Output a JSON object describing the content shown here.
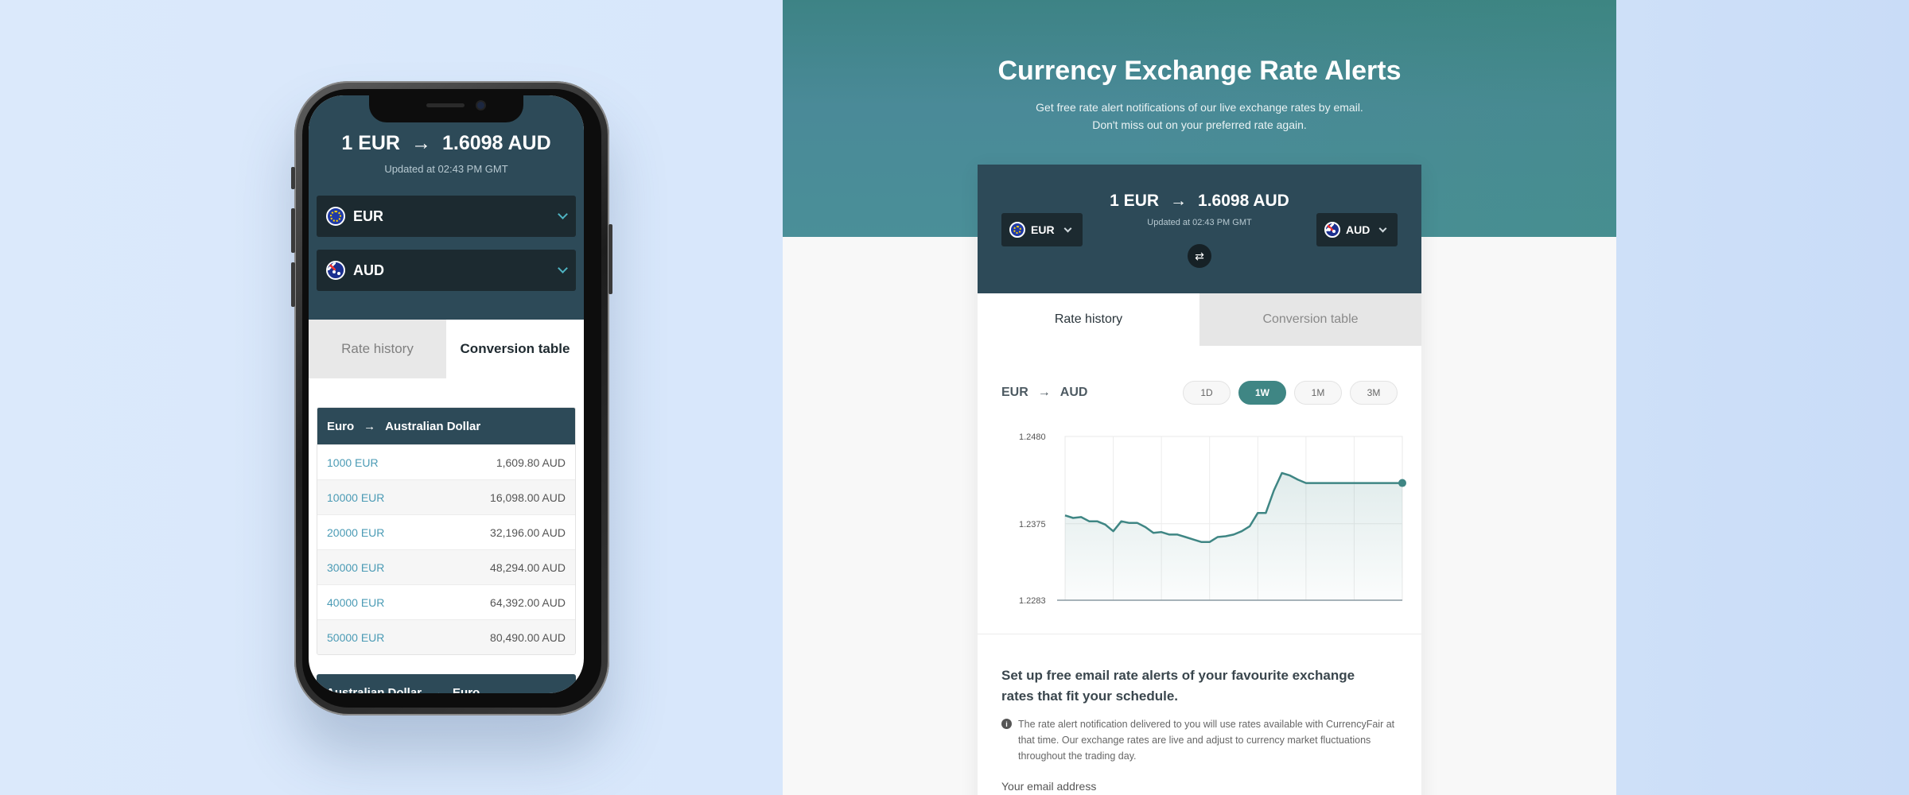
{
  "rate": {
    "from_text": "1 EUR",
    "to_text": "1.6098 AUD",
    "updated": "Updated at 02:43 PM GMT"
  },
  "mobile": {
    "from_currency": "EUR",
    "to_currency": "AUD",
    "tabs": {
      "history": "Rate history",
      "conversion": "Conversion table"
    },
    "active_tab": "conversion",
    "table1": {
      "from": "Euro",
      "to": "Australian Dollar",
      "rows": [
        {
          "amount": "1000 EUR",
          "value": "1,609.80 AUD"
        },
        {
          "amount": "10000 EUR",
          "value": "16,098.00 AUD"
        },
        {
          "amount": "20000 EUR",
          "value": "32,196.00 AUD"
        },
        {
          "amount": "30000 EUR",
          "value": "48,294.00 AUD"
        },
        {
          "amount": "40000 EUR",
          "value": "64,392.00 AUD"
        },
        {
          "amount": "50000 EUR",
          "value": "80,490.00 AUD"
        }
      ]
    },
    "table2": {
      "from": "Australian Dollar",
      "to": "Euro"
    }
  },
  "desktop": {
    "title": "Currency Exchange Rate Alerts",
    "subtitle": "Get free rate alert notifications of our live exchange rates by email. Don't miss out on your preferred rate again.",
    "from_currency": "EUR",
    "to_currency": "AUD",
    "tabs": {
      "history": "Rate history",
      "conversion": "Conversion table"
    },
    "active_tab": "history",
    "pair": {
      "from": "EUR",
      "to": "AUD"
    },
    "periods": [
      "1D",
      "1W",
      "1M",
      "3M"
    ],
    "active_period": "1W",
    "alert_heading": "Set up free email rate alerts of your favourite exchange rates that fit your schedule.",
    "info_text": "The rate alert notification delivered to you will use rates available with CurrencyFair at that time. Our exchange rates are live and adjust to currency market fluctuations throughout the trading day.",
    "email_label": "Your email address"
  },
  "icons": {
    "swap": "swap-arrows-icon",
    "info": "info-icon",
    "chevron": "chevron-down-icon",
    "arrow": "arrow-right-icon"
  },
  "colors": {
    "accent": "#3f8684",
    "header_dark": "#2d4a58",
    "link": "#4b9bb5"
  },
  "chart_data": {
    "type": "area",
    "title": "",
    "xlabel": "",
    "ylabel": "",
    "yticks": [
      "1.2480",
      "1.2375",
      "1.2283"
    ],
    "ylim": [
      1.2283,
      1.248
    ],
    "grid": true,
    "x": [
      0,
      1,
      2,
      3,
      4,
      5,
      6,
      7,
      8,
      9,
      10,
      11,
      12,
      13,
      14,
      15,
      16,
      17,
      18,
      19,
      20,
      21,
      22,
      23,
      24,
      25,
      26,
      27,
      28,
      29,
      30,
      31,
      32,
      33,
      34,
      35,
      36,
      37,
      38,
      39,
      40,
      41,
      42
    ],
    "values": [
      1.2385,
      1.2382,
      1.2383,
      1.2378,
      1.2378,
      1.2374,
      1.2366,
      1.2378,
      1.2376,
      1.2376,
      1.2371,
      1.2364,
      1.2365,
      1.2362,
      1.2362,
      1.2359,
      1.2356,
      1.2353,
      1.2353,
      1.2359,
      1.236,
      1.2362,
      1.2366,
      1.2372,
      1.2388,
      1.2388,
      1.2415,
      1.2436,
      1.2433,
      1.2428,
      1.2424,
      1.2424,
      1.2424,
      1.2424,
      1.2424,
      1.2424,
      1.2424,
      1.2424,
      1.2424,
      1.2424,
      1.2424,
      1.2424,
      1.2424
    ]
  }
}
